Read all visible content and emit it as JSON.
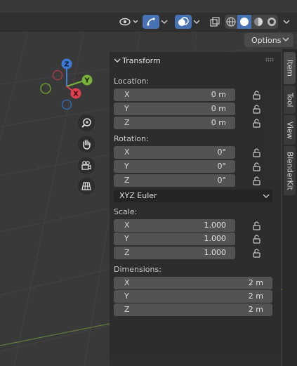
{
  "header": {
    "options_label": "Options",
    "icons": [
      "visibility-icon",
      "gizmo-toggle-icon",
      "overlay-toggle-icon",
      "xray-toggle-icon",
      "wireframe-shading-icon",
      "solid-shading-icon",
      "material-shading-icon",
      "rendered-shading-icon"
    ]
  },
  "gizmo": {
    "axes": [
      "Z",
      "Y",
      "X"
    ],
    "colors": {
      "x": "#e0404f",
      "y": "#79b23a",
      "z": "#3d7bd6"
    }
  },
  "transform": {
    "title": "Transform",
    "location": {
      "label": "Location:",
      "x": {
        "axis": "X",
        "value": "0 m"
      },
      "y": {
        "axis": "Y",
        "value": "0 m"
      },
      "z": {
        "axis": "Z",
        "value": "0 m"
      }
    },
    "rotation": {
      "label": "Rotation:",
      "x": {
        "axis": "X",
        "value": "0°"
      },
      "y": {
        "axis": "Y",
        "value": "0°"
      },
      "z": {
        "axis": "Z",
        "value": "0°"
      },
      "mode": "XYZ Euler"
    },
    "scale": {
      "label": "Scale:",
      "x": {
        "axis": "X",
        "value": "1.000"
      },
      "y": {
        "axis": "Y",
        "value": "1.000"
      },
      "z": {
        "axis": "Z",
        "value": "1.000"
      }
    },
    "dimensions": {
      "label": "Dimensions:",
      "x": {
        "axis": "X",
        "value": "2 m"
      },
      "y": {
        "axis": "Y",
        "value": "2 m"
      },
      "z": {
        "axis": "Z",
        "value": "2 m"
      }
    }
  },
  "tabs": {
    "item": "Item",
    "tool": "Tool",
    "view": "View",
    "blenderkit": "BlenderKit"
  }
}
